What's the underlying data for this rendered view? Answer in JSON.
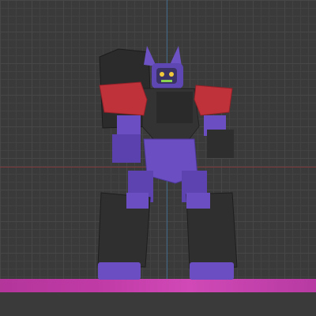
{
  "viewport": {
    "background": "#3a3a3a",
    "grid_visible": true,
    "axis_x_color": "#8a3a3a",
    "axis_y_color": "#3f6f93",
    "ground_color": "#c03aa6"
  },
  "model": {
    "subject": "robot-mech-figure",
    "colors": {
      "armor_purple": "#6b4fc2",
      "armor_dark": "#2e2e2e",
      "shoulder_red": "#c0323a",
      "eye_yellow": "#f1c83a"
    }
  }
}
